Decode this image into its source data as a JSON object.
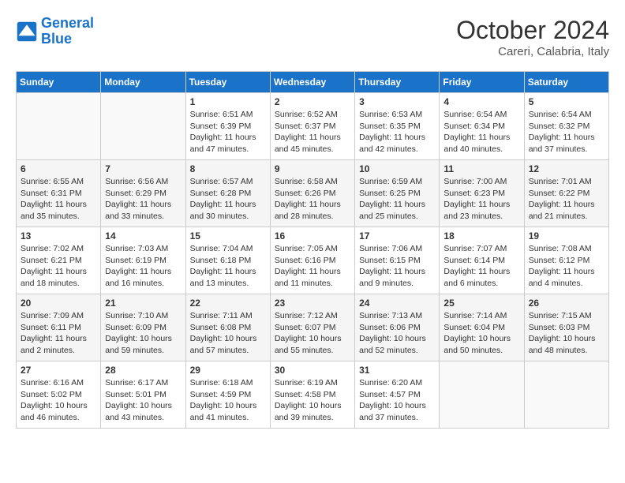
{
  "header": {
    "logo_line1": "General",
    "logo_line2": "Blue",
    "month": "October 2024",
    "location": "Careri, Calabria, Italy"
  },
  "weekdays": [
    "Sunday",
    "Monday",
    "Tuesday",
    "Wednesday",
    "Thursday",
    "Friday",
    "Saturday"
  ],
  "weeks": [
    [
      {
        "day": "",
        "info": ""
      },
      {
        "day": "",
        "info": ""
      },
      {
        "day": "1",
        "info": "Sunrise: 6:51 AM\nSunset: 6:39 PM\nDaylight: 11 hours and 47 minutes."
      },
      {
        "day": "2",
        "info": "Sunrise: 6:52 AM\nSunset: 6:37 PM\nDaylight: 11 hours and 45 minutes."
      },
      {
        "day": "3",
        "info": "Sunrise: 6:53 AM\nSunset: 6:35 PM\nDaylight: 11 hours and 42 minutes."
      },
      {
        "day": "4",
        "info": "Sunrise: 6:54 AM\nSunset: 6:34 PM\nDaylight: 11 hours and 40 minutes."
      },
      {
        "day": "5",
        "info": "Sunrise: 6:54 AM\nSunset: 6:32 PM\nDaylight: 11 hours and 37 minutes."
      }
    ],
    [
      {
        "day": "6",
        "info": "Sunrise: 6:55 AM\nSunset: 6:31 PM\nDaylight: 11 hours and 35 minutes."
      },
      {
        "day": "7",
        "info": "Sunrise: 6:56 AM\nSunset: 6:29 PM\nDaylight: 11 hours and 33 minutes."
      },
      {
        "day": "8",
        "info": "Sunrise: 6:57 AM\nSunset: 6:28 PM\nDaylight: 11 hours and 30 minutes."
      },
      {
        "day": "9",
        "info": "Sunrise: 6:58 AM\nSunset: 6:26 PM\nDaylight: 11 hours and 28 minutes."
      },
      {
        "day": "10",
        "info": "Sunrise: 6:59 AM\nSunset: 6:25 PM\nDaylight: 11 hours and 25 minutes."
      },
      {
        "day": "11",
        "info": "Sunrise: 7:00 AM\nSunset: 6:23 PM\nDaylight: 11 hours and 23 minutes."
      },
      {
        "day": "12",
        "info": "Sunrise: 7:01 AM\nSunset: 6:22 PM\nDaylight: 11 hours and 21 minutes."
      }
    ],
    [
      {
        "day": "13",
        "info": "Sunrise: 7:02 AM\nSunset: 6:21 PM\nDaylight: 11 hours and 18 minutes."
      },
      {
        "day": "14",
        "info": "Sunrise: 7:03 AM\nSunset: 6:19 PM\nDaylight: 11 hours and 16 minutes."
      },
      {
        "day": "15",
        "info": "Sunrise: 7:04 AM\nSunset: 6:18 PM\nDaylight: 11 hours and 13 minutes."
      },
      {
        "day": "16",
        "info": "Sunrise: 7:05 AM\nSunset: 6:16 PM\nDaylight: 11 hours and 11 minutes."
      },
      {
        "day": "17",
        "info": "Sunrise: 7:06 AM\nSunset: 6:15 PM\nDaylight: 11 hours and 9 minutes."
      },
      {
        "day": "18",
        "info": "Sunrise: 7:07 AM\nSunset: 6:14 PM\nDaylight: 11 hours and 6 minutes."
      },
      {
        "day": "19",
        "info": "Sunrise: 7:08 AM\nSunset: 6:12 PM\nDaylight: 11 hours and 4 minutes."
      }
    ],
    [
      {
        "day": "20",
        "info": "Sunrise: 7:09 AM\nSunset: 6:11 PM\nDaylight: 11 hours and 2 minutes."
      },
      {
        "day": "21",
        "info": "Sunrise: 7:10 AM\nSunset: 6:09 PM\nDaylight: 10 hours and 59 minutes."
      },
      {
        "day": "22",
        "info": "Sunrise: 7:11 AM\nSunset: 6:08 PM\nDaylight: 10 hours and 57 minutes."
      },
      {
        "day": "23",
        "info": "Sunrise: 7:12 AM\nSunset: 6:07 PM\nDaylight: 10 hours and 55 minutes."
      },
      {
        "day": "24",
        "info": "Sunrise: 7:13 AM\nSunset: 6:06 PM\nDaylight: 10 hours and 52 minutes."
      },
      {
        "day": "25",
        "info": "Sunrise: 7:14 AM\nSunset: 6:04 PM\nDaylight: 10 hours and 50 minutes."
      },
      {
        "day": "26",
        "info": "Sunrise: 7:15 AM\nSunset: 6:03 PM\nDaylight: 10 hours and 48 minutes."
      }
    ],
    [
      {
        "day": "27",
        "info": "Sunrise: 6:16 AM\nSunset: 5:02 PM\nDaylight: 10 hours and 46 minutes."
      },
      {
        "day": "28",
        "info": "Sunrise: 6:17 AM\nSunset: 5:01 PM\nDaylight: 10 hours and 43 minutes."
      },
      {
        "day": "29",
        "info": "Sunrise: 6:18 AM\nSunset: 4:59 PM\nDaylight: 10 hours and 41 minutes."
      },
      {
        "day": "30",
        "info": "Sunrise: 6:19 AM\nSunset: 4:58 PM\nDaylight: 10 hours and 39 minutes."
      },
      {
        "day": "31",
        "info": "Sunrise: 6:20 AM\nSunset: 4:57 PM\nDaylight: 10 hours and 37 minutes."
      },
      {
        "day": "",
        "info": ""
      },
      {
        "day": "",
        "info": ""
      }
    ]
  ]
}
